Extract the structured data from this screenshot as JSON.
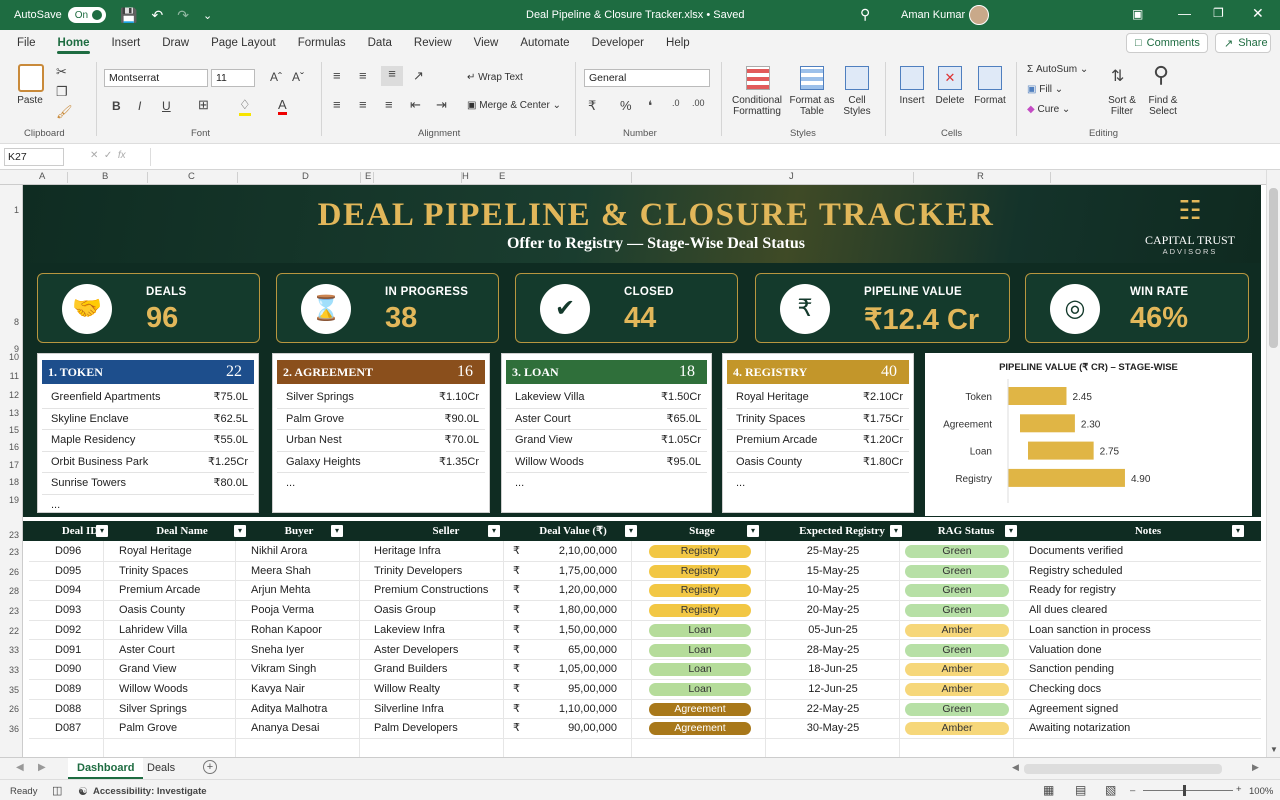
{
  "titlebar": {
    "autosave": "AutoSave",
    "autosave_state": "On",
    "doc_title": "Deal Pipeline & Closure Tracker.xlsx  •  Saved",
    "user": "Aman Kumar"
  },
  "menu": [
    "File",
    "Home",
    "Insert",
    "Draw",
    "Page Layout",
    "Formulas",
    "Data",
    "Review",
    "View",
    "Automate",
    "Developer",
    "Help"
  ],
  "menu_active": "Home",
  "topbuttons": {
    "comments": "Comments",
    "share": "Share"
  },
  "ribbon": {
    "paste": "Paste",
    "clipboard": "Clipboard",
    "font_name": "Montserrat",
    "font_size": "11",
    "font": "Font",
    "wrap_text": "Wrap Text",
    "merge_center": "Merge & Center",
    "alignment": "Alignment",
    "number_format": "General",
    "number": "Number",
    "conditional": "Conditional",
    "formatting": "Formatting",
    "format_as": "Format as",
    "table": "Table",
    "cell": "Cell",
    "styles_btn": "Styles",
    "styles": "Styles",
    "insert": "Insert",
    "delete": "Delete",
    "format": "Format",
    "cells": "Cells",
    "autosum": "AutoSum",
    "fill": "Fill",
    "clear": "Cure",
    "sort": "Sort &",
    "filter": "Filter",
    "find": "Find &",
    "select": "Select",
    "editing": "Editing"
  },
  "namebox": "K27",
  "columns": [
    "A",
    "B",
    "C",
    "D",
    "E",
    "H",
    "E",
    "J",
    "R"
  ],
  "rows": [
    "1",
    "",
    "",
    "",
    "",
    "",
    "",
    "8",
    "9",
    "10",
    "11",
    "12",
    "13",
    "15",
    "16",
    "17",
    "18",
    "19",
    "23",
    "23",
    "26",
    "28",
    "23",
    "22",
    "33",
    "33",
    "35",
    "26",
    "36"
  ],
  "banner": {
    "title": "DEAL PIPELINE & CLOSURE TRACKER",
    "subtitle": "Offer to Registry — Stage-Wise Deal Status",
    "logo_line1": "CAPITAL TRUST",
    "logo_line2": "ADVISORS"
  },
  "kpis": [
    {
      "label": "DEALS",
      "value": "96",
      "icon": "handshake-icon"
    },
    {
      "label": "IN PROGRESS",
      "value": "38",
      "icon": "hourglass-icon"
    },
    {
      "label": "CLOSED",
      "value": "44",
      "icon": "check-icon"
    },
    {
      "label": "PIPELINE VALUE",
      "value": "₹12.4 Cr",
      "icon": "rupee-icon"
    },
    {
      "label": "WIN RATE",
      "value": "46%",
      "icon": "target-icon"
    }
  ],
  "stages": [
    {
      "title": "1. TOKEN",
      "count": "22",
      "color": "#1d4e8c",
      "items": [
        [
          "Greenfield Apartments",
          "₹75.0L"
        ],
        [
          "Skyline Enclave",
          "₹62.5L"
        ],
        [
          "Maple Residency",
          "₹55.0L"
        ],
        [
          "Orbit Business Park",
          "₹1.25Cr"
        ],
        [
          "Sunrise Towers",
          "₹80.0L"
        ],
        [
          "...",
          ""
        ]
      ]
    },
    {
      "title": "2. AGREEMENT",
      "count": "16",
      "color": "#8a4f1c",
      "items": [
        [
          "Silver Springs",
          "₹1.10Cr"
        ],
        [
          "Palm Grove",
          "₹90.0L"
        ],
        [
          "Urban Nest",
          "₹70.0L"
        ],
        [
          "Galaxy Heights",
          "₹1.35Cr"
        ],
        [
          "...",
          ""
        ]
      ]
    },
    {
      "title": "3. LOAN",
      "count": "18",
      "color": "#2f6f3a",
      "items": [
        [
          "Lakeview Villa",
          "₹1.50Cr"
        ],
        [
          "Aster Court",
          "₹65.0L"
        ],
        [
          "Grand View",
          "₹1.05Cr"
        ],
        [
          "Willow Woods",
          "₹95.0L"
        ],
        [
          "...",
          ""
        ]
      ]
    },
    {
      "title": "4. REGISTRY",
      "count": "40",
      "color": "#c3962a",
      "items": [
        [
          "Royal Heritage",
          "₹2.10Cr"
        ],
        [
          "Trinity Spaces",
          "₹1.75Cr"
        ],
        [
          "Premium Arcade",
          "₹1.20Cr"
        ],
        [
          "Oasis County",
          "₹1.80Cr"
        ],
        [
          "...",
          ""
        ]
      ]
    }
  ],
  "chart_data": {
    "type": "bar",
    "orientation": "horizontal",
    "title": "PIPELINE VALUE (₹ CR) – STAGE-WISE",
    "categories": [
      "Token",
      "Agreement",
      "Loan",
      "Registry"
    ],
    "values": [
      2.45,
      2.3,
      2.75,
      4.9
    ],
    "value_labels": [
      "2.45",
      "2.30",
      "2.75",
      "4.90"
    ],
    "color": "#e0b545",
    "xlim": [
      0,
      5
    ]
  },
  "table": {
    "headers": [
      "Deal ID",
      "Deal Name",
      "Buyer",
      "Seller",
      "Deal Value (₹)",
      "Stage",
      "Expected Registry",
      "RAG Status",
      "Notes"
    ],
    "currency": "₹",
    "rows": [
      [
        "D096",
        "Royal Heritage",
        "Nikhil Arora",
        "Heritage Infra",
        "2,10,00,000",
        "Registry",
        "25-May-25",
        "Green",
        "Documents verified"
      ],
      [
        "D095",
        "Trinity Spaces",
        "Meera Shah",
        "Trinity Developers",
        "1,75,00,000",
        "Registry",
        "15-May-25",
        "Green",
        "Registry scheduled"
      ],
      [
        "D094",
        "Premium Arcade",
        "Arjun Mehta",
        "Premium Constructions",
        "1,20,00,000",
        "Registry",
        "10-May-25",
        "Green",
        "Ready for registry"
      ],
      [
        "D093",
        "Oasis County",
        "Pooja Verma",
        "Oasis Group",
        "1,80,00,000",
        "Registry",
        "20-May-25",
        "Green",
        "All dues cleared"
      ],
      [
        "D092",
        "Lahridew Villa",
        "Rohan Kapoor",
        "Lakeview Infra",
        "1,50,00,000",
        "Loan",
        "05-Jun-25",
        "Amber",
        "Loan sanction in process"
      ],
      [
        "D091",
        "Aster Court",
        "Sneha Iyer",
        "Aster Developers",
        "65,00,000",
        "Loan",
        "28-May-25",
        "Green",
        "Valuation done"
      ],
      [
        "D090",
        "Grand View",
        "Vikram Singh",
        "Grand Builders",
        "1,05,00,000",
        "Loan",
        "18-Jun-25",
        "Amber",
        "Sanction pending"
      ],
      [
        "D089",
        "Willow Woods",
        "Kavya Nair",
        "Willow Realty",
        "95,00,000",
        "Loan",
        "12-Jun-25",
        "Amber",
        "Checking docs"
      ],
      [
        "D088",
        "Silver Springs",
        "Aditya Malhotra",
        "Silverline Infra",
        "1,10,00,000",
        "Agreement",
        "22-May-25",
        "Green",
        "Agreement signed"
      ],
      [
        "D087",
        "Palm Grove",
        "Ananya Desai",
        "Palm Developers",
        "90,00,000",
        "Agreement",
        "30-May-25",
        "Amber",
        "Awaiting notarization"
      ]
    ],
    "stage_colors": {
      "Registry": "#f2c744",
      "Loan": "#b5dc9a",
      "Agreement": "#a8781a"
    },
    "rag_colors": {
      "Green": "#b7e0a6",
      "Amber": "#f6d77a"
    }
  },
  "sheets": [
    "Dashboard",
    "Deals"
  ],
  "active_sheet": "Dashboard",
  "status": {
    "ready": "Ready",
    "accessibility": "Accessibility: Investigate",
    "zoom": "100%"
  }
}
